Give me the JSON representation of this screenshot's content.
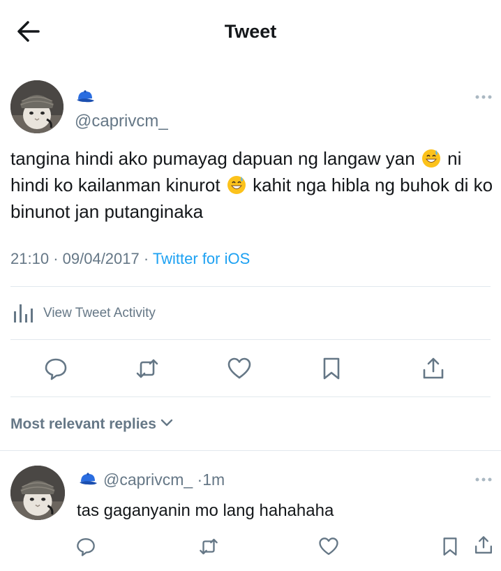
{
  "header": {
    "title": "Tweet"
  },
  "tweet": {
    "handle": "@caprivcm_",
    "text_part1": "tangina hindi ako pumayag dapuan ng langaw yan",
    "text_part2": "ni hindi ko kailanman kinurot",
    "text_part3": "kahit nga hibla ng buhok di ko binunot jan putanginaka",
    "time": "21:10",
    "date": "09/04/2017",
    "separator": "·",
    "source": "Twitter for iOS",
    "activity_label": "View Tweet Activity"
  },
  "replies": {
    "sort_label": "Most relevant replies",
    "items": [
      {
        "handle": "@caprivcm_",
        "age": "1m",
        "text": "tas gaganyanin mo lang hahahaha"
      }
    ]
  },
  "colors": {
    "accent": "#1da1f2",
    "secondary_text": "#657786",
    "divider": "#e1e8ed",
    "cap": "#2a6de0"
  },
  "icons": {
    "back": "arrow-left-icon",
    "cap": "billed-cap-emoji",
    "sweat": "grinning-sweat-emoji",
    "reply": "speech-bubble-icon",
    "retweet": "retweet-icon",
    "like": "heart-icon",
    "bookmark": "bookmark-icon",
    "share": "share-icon",
    "activity": "bar-chart-icon",
    "more": "ellipsis-icon"
  }
}
